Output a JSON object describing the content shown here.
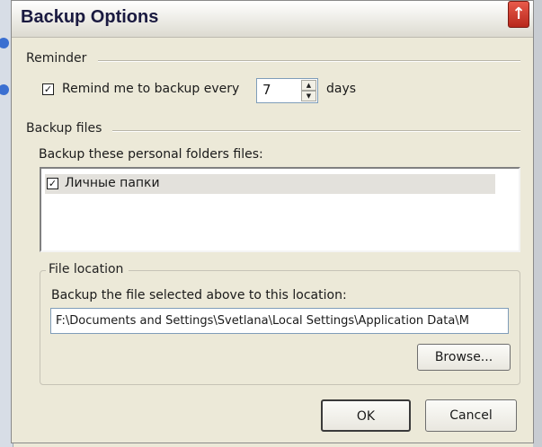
{
  "dialog": {
    "title": "Backup Options",
    "close_glyph": "↑"
  },
  "reminder": {
    "group_label": "Reminder",
    "checkbox_checked": true,
    "text_before": "Remind me to backup every",
    "days_value": "7",
    "text_after": "days"
  },
  "backup_files": {
    "group_label": "Backup files",
    "list_caption": "Backup these personal folders files:",
    "items": [
      {
        "label": "Личные папки",
        "checked": true
      }
    ]
  },
  "file_location": {
    "group_label": "File location",
    "caption": "Backup the file selected above to this location:",
    "path": "F:\\Documents and Settings\\Svetlana\\Local Settings\\Application Data\\M",
    "browse_label": "Browse..."
  },
  "buttons": {
    "ok": "OK",
    "cancel": "Cancel"
  },
  "glyphs": {
    "check": "✓",
    "spin_up": "▲",
    "spin_down": "▼"
  }
}
